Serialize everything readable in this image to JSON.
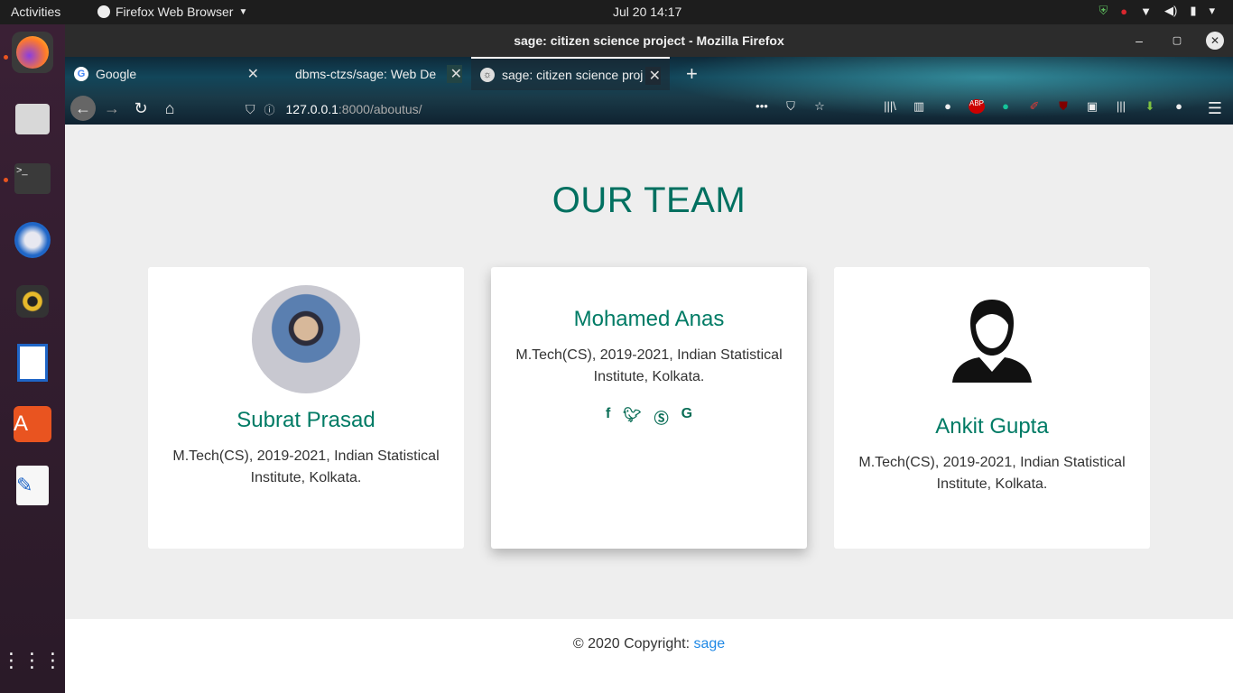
{
  "system": {
    "activities": "Activities",
    "app_menu": "Firefox Web Browser",
    "clock": "Jul 20  14:17"
  },
  "window": {
    "title": "sage: citizen science project - Mozilla Firefox"
  },
  "tabs": [
    {
      "label": "Google"
    },
    {
      "label": "dbms-ctzs/sage: Web De"
    },
    {
      "label": "sage: citizen science proj"
    }
  ],
  "url": {
    "host": "127.0.0.1",
    "path": ":8000/aboutus/"
  },
  "page": {
    "heading": "OUR TEAM",
    "members": [
      {
        "name": "Subrat Prasad",
        "desc": "M.Tech(CS), 2019-2021, Indian Statistical Institute, Kolkata."
      },
      {
        "name": "Mohamed Anas",
        "desc": "M.Tech(CS), 2019-2021, Indian Statistical Institute, Kolkata."
      },
      {
        "name": "Ankit Gupta",
        "desc": "M.Tech(CS), 2019-2021, Indian Statistical Institute, Kolkata."
      }
    ],
    "footer_prefix": "© 2020 Copyright: ",
    "footer_link": "sage"
  },
  "colors": {
    "accent": "#007b65",
    "link": "#1e88e5"
  }
}
